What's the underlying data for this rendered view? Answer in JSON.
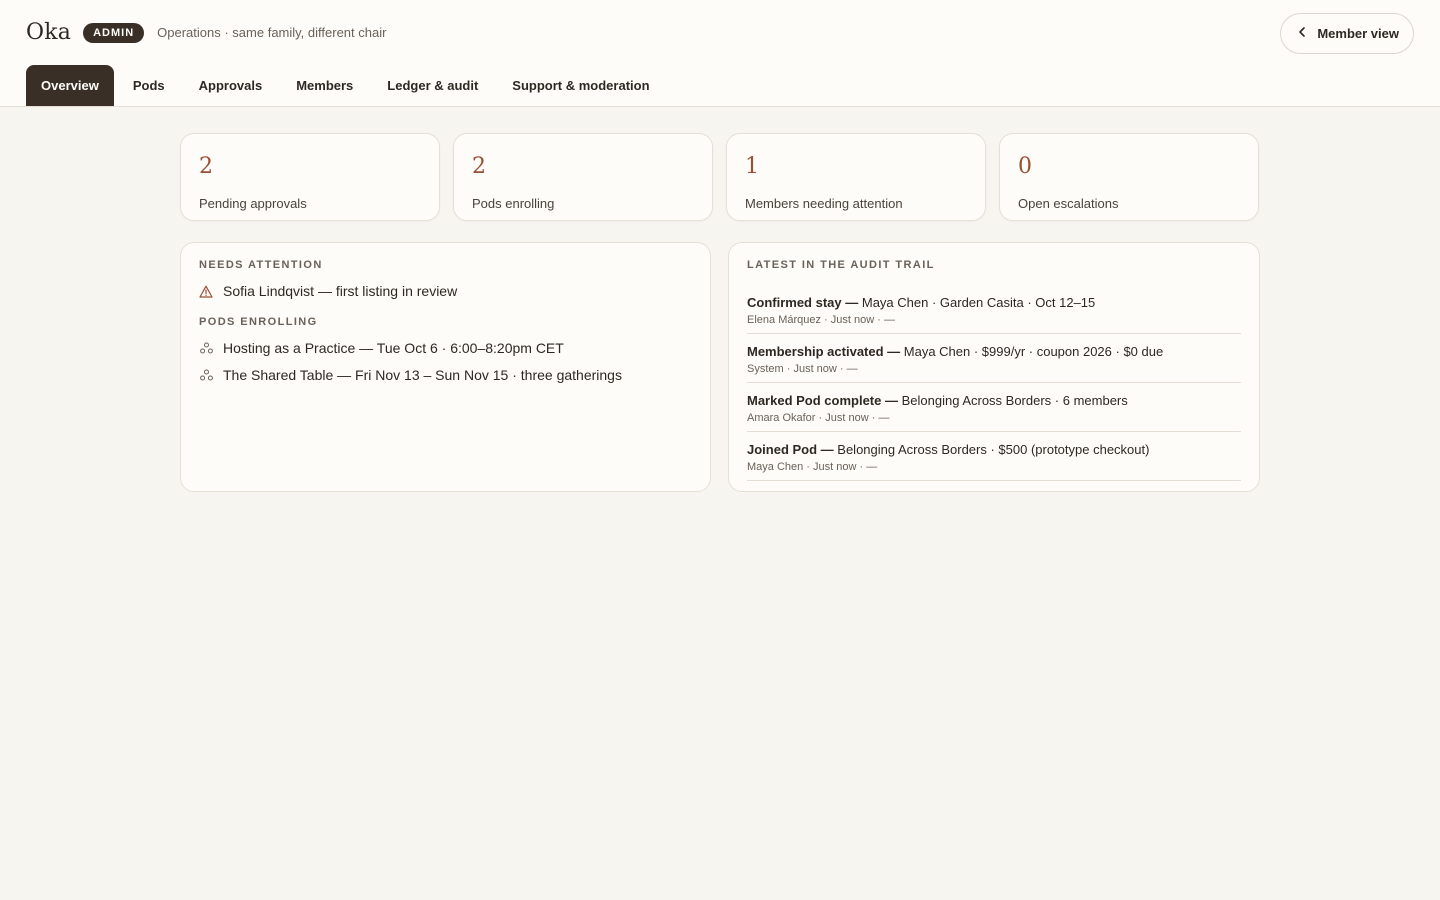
{
  "header": {
    "logo": "Oka",
    "badge": "ADMIN",
    "tagline": "Operations · same family, different chair",
    "member_view_label": "Member view"
  },
  "tabs": [
    {
      "label": "Overview",
      "active": true
    },
    {
      "label": "Pods",
      "active": false
    },
    {
      "label": "Approvals",
      "active": false
    },
    {
      "label": "Members",
      "active": false
    },
    {
      "label": "Ledger & audit",
      "active": false
    },
    {
      "label": "Support & moderation",
      "active": false
    }
  ],
  "stats": [
    {
      "value": "2",
      "label": "Pending approvals"
    },
    {
      "value": "2",
      "label": "Pods enrolling"
    },
    {
      "value": "1",
      "label": "Members needing attention"
    },
    {
      "value": "0",
      "label": "Open escalations"
    }
  ],
  "needs_attention": {
    "title": "NEEDS ATTENTION",
    "items": [
      {
        "icon": "warning-icon",
        "text": "Sofia Lindqvist — first listing in review"
      }
    ]
  },
  "pods_enrolling": {
    "title": "PODS ENROLLING",
    "items": [
      {
        "icon": "pod-icon",
        "text": "Hosting as a Practice — Tue Oct 6 · 6:00–8:20pm CET"
      },
      {
        "icon": "pod-icon",
        "text": "The Shared Table — Fri Nov 13 – Sun Nov 15 · three gatherings"
      }
    ]
  },
  "audit": {
    "title": "LATEST IN THE AUDIT TRAIL",
    "rows": [
      {
        "action": "Confirmed stay —",
        "detail": " Maya Chen · Garden Casita · Oct 12–15",
        "meta": "Elena Márquez · Just now · —"
      },
      {
        "action": "Membership activated —",
        "detail": " Maya Chen · $999/yr · coupon 2026 · $0 due",
        "meta": "System · Just now · —"
      },
      {
        "action": "Marked Pod complete —",
        "detail": " Belonging Across Borders · 6 members",
        "meta": "Amara Okafor · Just now · —"
      },
      {
        "action": "Joined Pod —",
        "detail": " Belonging Across Borders · $500 (prototype checkout)",
        "meta": "Maya Chen · Just now · —"
      }
    ]
  },
  "colors": {
    "accent": "#9a4e36",
    "dark": "#3a2f27",
    "background": "#f7f5f0"
  }
}
